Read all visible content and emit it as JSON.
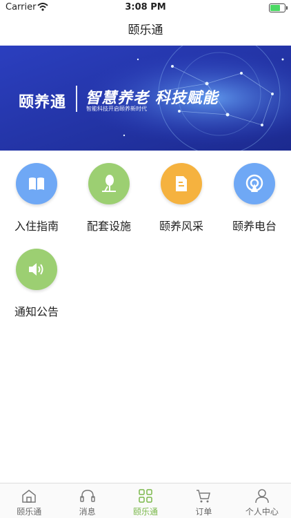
{
  "status_bar": {
    "carrier": "Carrier",
    "time": "3:08 PM"
  },
  "nav": {
    "title": "颐乐通"
  },
  "banner": {
    "brand": "颐养通",
    "slogan": "智慧养老  科技赋能",
    "slogan_sub": "智能科技开启颐养新时代"
  },
  "menu": [
    {
      "label": "入住指南",
      "icon": "book-icon",
      "color": "#6fa8f5"
    },
    {
      "label": "配套设施",
      "icon": "tree-icon",
      "color": "#9ccf72"
    },
    {
      "label": "颐养风采",
      "icon": "building-icon",
      "color": "#f5b23f"
    },
    {
      "label": "颐养电台",
      "icon": "radio-icon",
      "color": "#6fa8f5"
    },
    {
      "label": "通知公告",
      "icon": "speaker-icon",
      "color": "#9ccf72"
    }
  ],
  "tabs": [
    {
      "label": "颐乐通",
      "icon": "home-icon",
      "active": false
    },
    {
      "label": "消息",
      "icon": "headset-icon",
      "active": false
    },
    {
      "label": "颐乐通",
      "icon": "grid-icon",
      "active": true
    },
    {
      "label": "订单",
      "icon": "cart-icon",
      "active": false
    },
    {
      "label": "个人中心",
      "icon": "user-icon",
      "active": false
    }
  ],
  "colors": {
    "accent": "#7ab84a",
    "banner_bg": "#2a3ab3"
  }
}
